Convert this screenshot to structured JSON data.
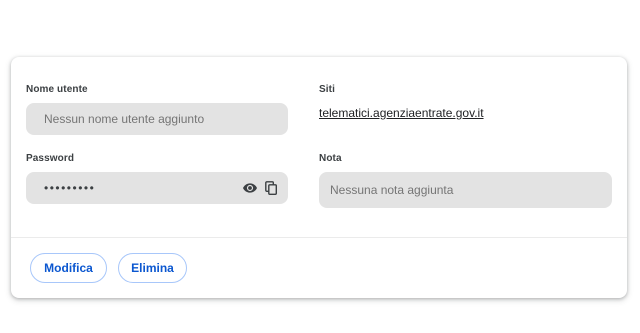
{
  "username": {
    "label": "Nome utente",
    "placeholder": "Nessun nome utente aggiunto"
  },
  "sites": {
    "label": "Siti",
    "link": "telematici.agenziaentrate.gov.it"
  },
  "password": {
    "label": "Password",
    "masked_value": "•••••••••",
    "show_icon": "eye-icon",
    "copy_icon": "copy-icon"
  },
  "note": {
    "label": "Nota",
    "placeholder": "Nessuna nota aggiunta"
  },
  "actions": {
    "edit_label": "Modifica",
    "delete_label": "Elimina"
  },
  "colors": {
    "field_bg": "#e3e3e3",
    "button_text": "#0b57d0",
    "button_border": "#a8c7fa"
  }
}
